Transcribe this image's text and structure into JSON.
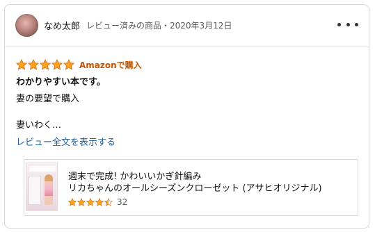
{
  "review": {
    "username": "なめ太郎",
    "meta": "レビュー済みの商品・2020年3月12日",
    "rating": 5,
    "verified_label": "Amazonで購入",
    "title": "わかりやすい本です。",
    "body_lines": [
      "妻の要望で購入",
      "",
      "妻いわく…"
    ],
    "read_more": "レビュー全文を表示する"
  },
  "product": {
    "title_line1": "週末で完成! かわいいかぎ針編み",
    "title_line2": "リカちゃんのオールシーズンクローゼット (アサヒオリジナル)",
    "rating": 4.5,
    "rating_count": "32"
  },
  "colors": {
    "star_fill": "#ffa41c",
    "star_outline": "#de7921",
    "verified": "#c45500",
    "link": "#2162a1"
  }
}
